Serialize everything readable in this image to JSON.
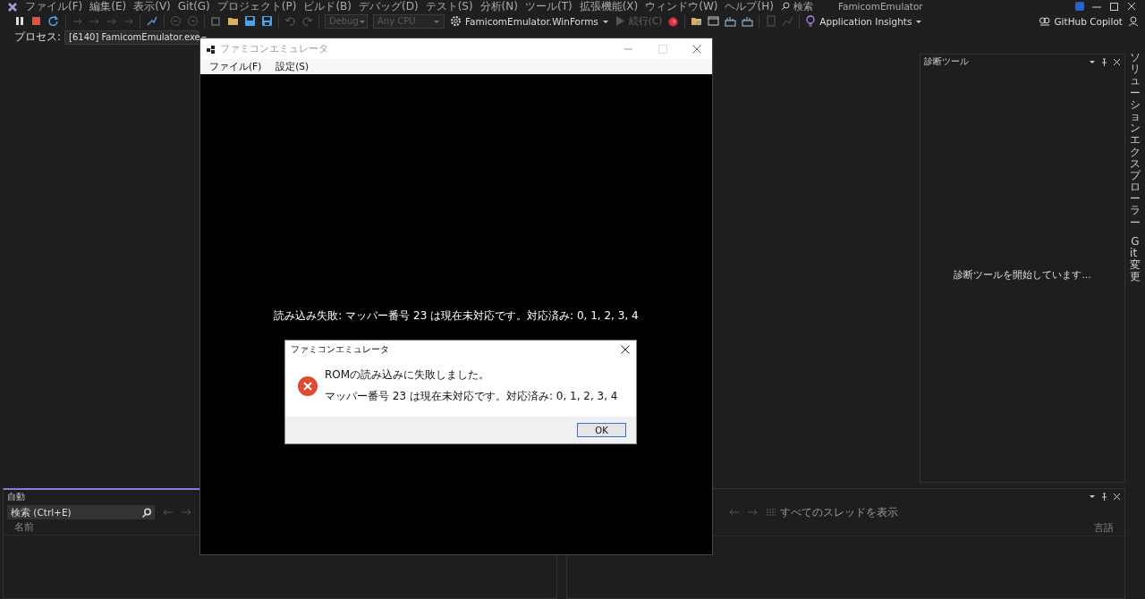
{
  "menu_bar": {
    "items": [
      "ファイル(F)",
      "編集(E)",
      "表示(V)",
      "Git(G)",
      "プロジェクト(P)",
      "ビルド(B)",
      "デバッグ(D)",
      "テスト(S)",
      "分析(N)",
      "ツール(T)",
      "拡張機能(X)",
      "ウィンドウ(W)",
      "ヘルプ(H)"
    ],
    "search": "検索",
    "solution_name": "FamicomEmulator"
  },
  "toolbar": {
    "configuration": {
      "label": "Debug",
      "disabled": true
    },
    "platform": {
      "label": "Any CPU",
      "disabled": true
    },
    "startup_project": "FamicomEmulator.WinForms",
    "continue": {
      "label": "続行(C)",
      "disabled": true
    },
    "app_insights": "Application Insights",
    "copilot": "GitHub Copilot"
  },
  "process_bar": {
    "label": "プロセス:",
    "process": "[6140] FamicomEmulator.exe"
  },
  "diagnostics": {
    "title": "診断ツール",
    "message": "診断ツールを開始しています..."
  },
  "side_tabs": [
    "ソリューションエクスプローラー",
    "Git 変更"
  ],
  "autos": {
    "title": "自動",
    "search": {
      "placeholder": "検索 (Ctrl+E)"
    },
    "column": "名前"
  },
  "threads": {
    "show_all": "すべてのスレッドを表示",
    "column": "言語"
  },
  "emulator": {
    "title": "ファミコンエミュレータ",
    "menu": [
      "ファイル(F)",
      "設定(S)"
    ],
    "status": "読み込み失敗: マッパー番号 23 は現在未対応です。対応済み: 0, 1, 2, 3, 4"
  },
  "dialog": {
    "title": "ファミコンエミュレータ",
    "heading": "ROMの読み込みに失敗しました。",
    "detail": "マッパー番号 23 は現在未対応です。対応済み: 0, 1, 2, 3, 4",
    "button": "OK"
  }
}
